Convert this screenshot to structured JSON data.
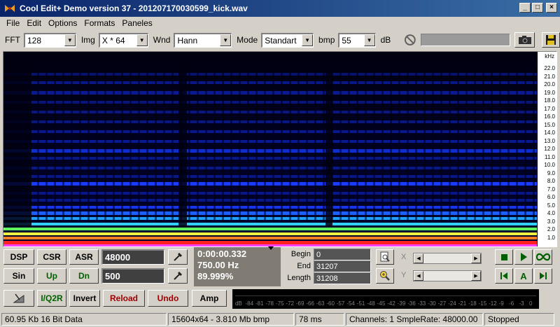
{
  "window": {
    "title": "Cool Edit+  Demo version 37 - 201207170030599_kick.wav",
    "minimize": "_",
    "maximize": "□",
    "close": "×"
  },
  "menu": [
    "File",
    "Edit",
    "Options",
    "Formats",
    "Paneles"
  ],
  "toolbar": {
    "fft_label": "FFT",
    "fft_value": "128",
    "img_label": "Img",
    "img_value": "X * 64",
    "wnd_label": "Wnd",
    "wnd_value": "Hann",
    "mode_label": "Mode",
    "mode_value": "Standart",
    "bmp_label": "bmp",
    "bmp_value": "55",
    "db_label": "dB"
  },
  "spectrogram": {
    "unit": "kHz",
    "ticks": [
      "22.0",
      "21.0",
      "20.0",
      "19.0",
      "18.0",
      "17.0",
      "16.0",
      "15.0",
      "14.0",
      "13.0",
      "12.0",
      "11.0",
      "10.0",
      "9.0",
      "8.0",
      "7.0",
      "6.0",
      "5.0",
      "4.0",
      "3.0",
      "2.0",
      "1.0"
    ]
  },
  "controls": {
    "dsp": "DSP",
    "csr": "CSR",
    "asr": "ASR",
    "sin": "Sin",
    "up": "Up",
    "dn": "Dn",
    "rate_value": "48000",
    "count_value": "500",
    "time": "0:00:00.332",
    "freq": "750.00 Hz",
    "percent": "89.999%",
    "begin_label": "Begin",
    "begin_value": "0",
    "end_label": "End",
    "end_value": "31207",
    "length_label": "Length",
    "length_value": "31208",
    "x_label": "X",
    "y_label": "Y",
    "a_label": "A"
  },
  "buttons2": {
    "iq2r": "I/Q2R",
    "invert": "Invert",
    "reload": "Reload",
    "undo": "Undo",
    "amp": "Amp"
  },
  "meter_scale": [
    "dB",
    "-84",
    "-81",
    "-78",
    "-75",
    "-72",
    "-69",
    "-66",
    "-63",
    "-60",
    "-57",
    "-54",
    "-51",
    "-48",
    "-45",
    "-42",
    "-39",
    "-36",
    "-33",
    "-30",
    "-27",
    "-24",
    "-21",
    "-18",
    "-15",
    "-12",
    "-9",
    "-6",
    "-3",
    "0"
  ],
  "status": {
    "s1": "60.95 Kb 16 Bit Data",
    "s2": "15604x64 - 3.810 Mb bmp",
    "s3": "78 ms",
    "s4": "Channels: 1  SmpleRate: 48000.00",
    "s5": "Stopped"
  },
  "colors": {
    "titlebar_start": "#0a246a",
    "titlebar_end": "#3a6ea5",
    "face": "#d4d0c8",
    "spectrum_bg": "#000010",
    "band_blue": "#1a3cff"
  }
}
